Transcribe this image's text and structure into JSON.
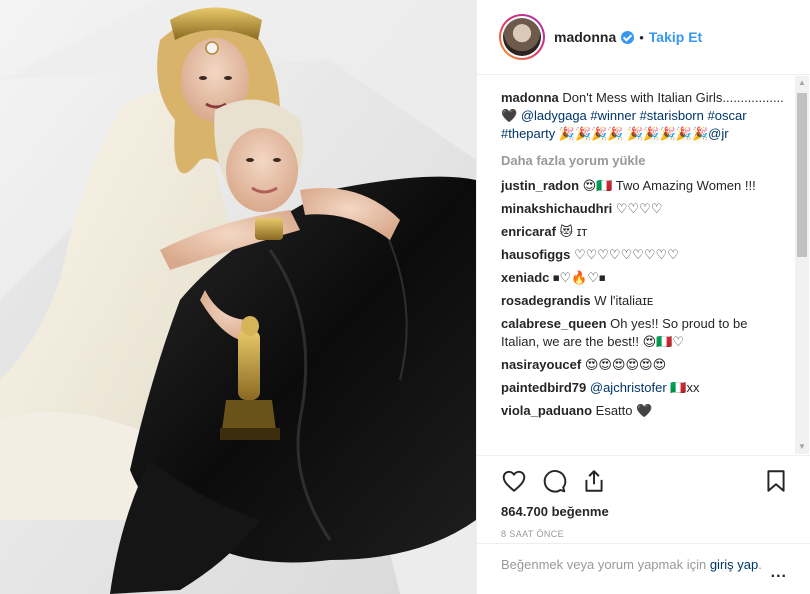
{
  "post": {
    "username": "madonna",
    "follow_label": "Takip Et",
    "separator": "•"
  },
  "caption": {
    "username": "madonna",
    "text_start": "Don't Mess with Italian Girls.................",
    "heart": "🖤",
    "mention_ladygaga": "@ladygaga",
    "tag_winner": "#winner",
    "tag_starisborn": "#starisborn",
    "tag_oscar": "#oscar",
    "tag_theparty": "#theparty",
    "emojis_1": "🎉🎉🎉🎉",
    "emojis_2": "🎉🎉🎉🎉🎉",
    "mention_jr": "@jr"
  },
  "load_more_label": "Daha fazla yorum yükle",
  "comments": [
    {
      "user": "justin_radon",
      "text": "😍🇮🇹 Two Amazing Women !!!"
    },
    {
      "user": "minakshichaudhri",
      "text": "♡♡♡♡"
    },
    {
      "user": "enricaraf",
      "text": "😻 ɪᴛ"
    },
    {
      "user": "hausofiggs",
      "text": "♡♡♡♡♡♡♡♡♡"
    },
    {
      "user": "xeniadc",
      "text": "⏹♡🔥♡⏹"
    },
    {
      "user": "rosadegrandis",
      "text": "W l'italiaɪᴇ"
    },
    {
      "user": "calabrese_queen",
      "text": "Oh yes!! So proud to be Italian, we are the best!! 😍🇮🇹♡"
    },
    {
      "user": "nasirayoucef",
      "text": "😍😍😍😍😍😍"
    },
    {
      "user": "paintedbird79",
      "mention": "@ajchristofer",
      "text": "🇮🇹xx"
    },
    {
      "user": "viola_paduano",
      "text": "Esatto 🖤"
    }
  ],
  "actions": {
    "likes": "864.700 beğenme",
    "time": "8 SAAT ÖNCE"
  },
  "add_comment": {
    "prefix": "Beğenmek veya yorum yapmak için",
    "login": "giriş yap",
    "suffix": ".",
    "more": "..."
  }
}
